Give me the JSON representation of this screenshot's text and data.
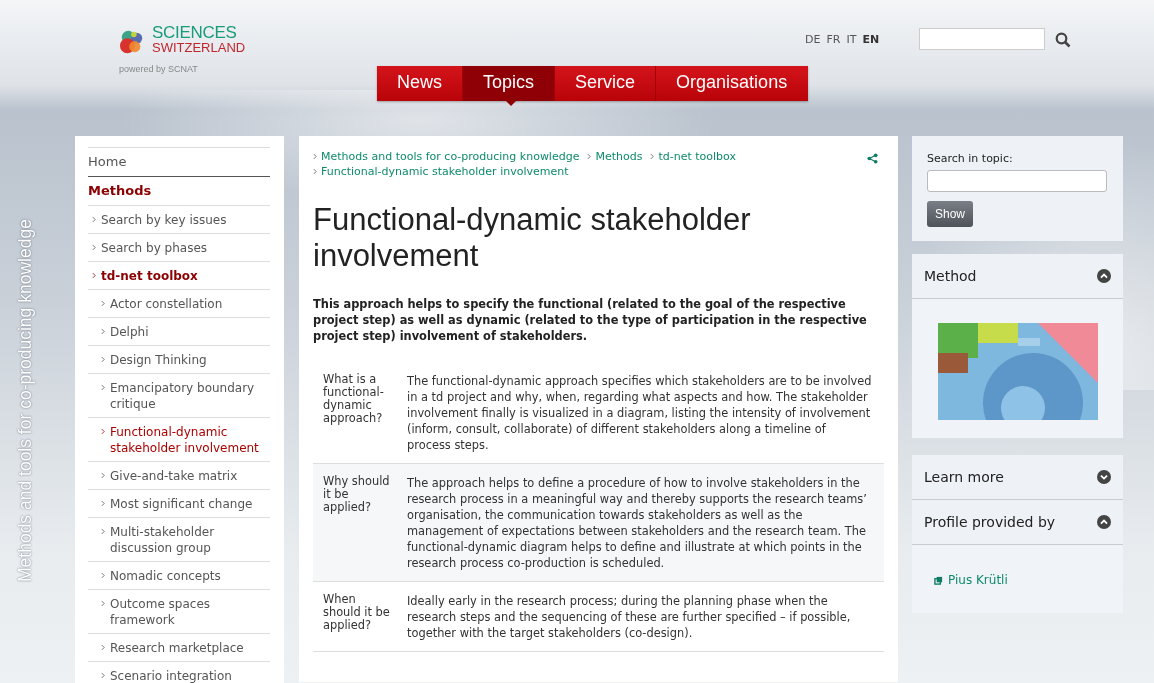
{
  "logo": {
    "title": "SCIENCES",
    "subtitle": "SWITZERLAND",
    "tagline": "powered by SCNAT"
  },
  "languages": [
    {
      "label": "DE",
      "selected": false
    },
    {
      "label": "FR",
      "selected": false
    },
    {
      "label": "IT",
      "selected": false
    },
    {
      "label": "EN",
      "selected": true
    }
  ],
  "nav": [
    {
      "label": "News",
      "selected": false
    },
    {
      "label": "Topics",
      "selected": true
    },
    {
      "label": "Service",
      "selected": false
    },
    {
      "label": "Organisations",
      "selected": false
    }
  ],
  "side_title": "Methods and tools for co-producing knowledge",
  "sidebar": {
    "items": [
      {
        "label": "Home",
        "selected": false
      },
      {
        "label": "Methods",
        "selected": false,
        "expanded": true,
        "children": [
          {
            "label": "Search by key issues",
            "selected": false
          },
          {
            "label": "Search by phases",
            "selected": false
          },
          {
            "label": "td-net toolbox",
            "selected": false,
            "expanded": true,
            "children": [
              {
                "label": "Actor constellation",
                "selected": false
              },
              {
                "label": "Delphi",
                "selected": false
              },
              {
                "label": "Design Thinking",
                "selected": false
              },
              {
                "label": "Emancipatory boundary critique",
                "selected": false
              },
              {
                "label": "Functional-dynamic stakeholder involvement",
                "selected": true
              },
              {
                "label": "Give-and-take matrix",
                "selected": false
              },
              {
                "label": "Most significant change",
                "selected": false
              },
              {
                "label": "Multi-stakeholder discussion group",
                "selected": false
              },
              {
                "label": "Nomadic concepts",
                "selected": false
              },
              {
                "label": "Outcome spaces framework",
                "selected": false
              },
              {
                "label": "Research marketplace",
                "selected": false
              },
              {
                "label": "Scenario integration",
                "selected": false
              }
            ]
          }
        ]
      }
    ]
  },
  "breadcrumbs": [
    "Methods and tools for co-producing knowledge",
    "Methods",
    "td-net toolbox",
    "Functional-dynamic stakeholder involvement"
  ],
  "title": "Functional-dynamic stakeholder involvement",
  "lead": "This approach helps to specify the functional (related to the goal of the respective project step) as well as dynamic (related to the type of participation in the respective project step) involvement of stakeholders.",
  "table": {
    "rows": [
      {
        "label": "What is a functional-dynamic approach?",
        "text": "The functional-dynamic approach specifies which stakeholders are to be involved in a td project and why, when, regarding what aspects and how. The stakeholder involvement finally is visualized in a diagram, listing the intensity of involvement (inform, consult, collaborate) of different stakeholders along a timeline of process steps."
      },
      {
        "label": "Why should it be applied?",
        "text": "The approach helps to define a procedure of how to involve stakeholders in the research process in a meaningful way and thereby supports the research teams’ organisation, the communication towards stakeholders as well as the management of expectations between stakeholders and the research team. The functional-dynamic diagram helps to define and illustrate at which points in the research process co-production is scheduled."
      },
      {
        "label": "When should it be applied?",
        "text": "Ideally early in the research process; during the planning phase when the research steps and the sequencing of these are further specified – if possible, together with the target stakeholders (co-design)."
      }
    ]
  },
  "topic_search": {
    "label": "Search in topic:",
    "button": "Show"
  },
  "panels": [
    {
      "title": "Method",
      "expanded": true,
      "kind": "picture"
    },
    {
      "title": "Learn more",
      "expanded": false
    },
    {
      "title": "Profile provided by",
      "expanded": true,
      "kind": "link",
      "link": "Pius Krütli"
    }
  ]
}
